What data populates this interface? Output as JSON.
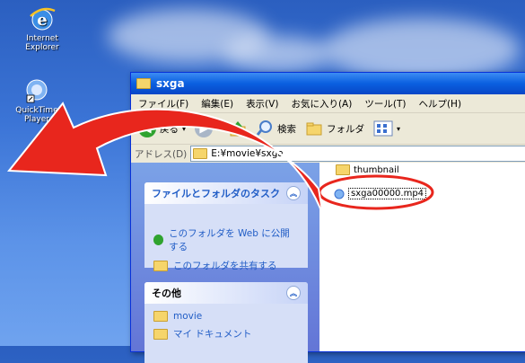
{
  "desktop": {
    "icons": [
      {
        "label": "Internet\nExplorer",
        "icon": "internet-explorer-icon"
      },
      {
        "label": "QuickTime\nPlayer",
        "icon": "quicktime-icon"
      }
    ]
  },
  "window": {
    "title": "sxga",
    "menu": [
      "ファイル(F)",
      "編集(E)",
      "表示(V)",
      "お気に入り(A)",
      "ツール(T)",
      "ヘルプ(H)"
    ],
    "toolbar": {
      "back": "戻る",
      "search": "検索",
      "folders": "フォルダ"
    },
    "address": {
      "label": "アドレス(D)",
      "path": "E:¥movie¥sxga"
    },
    "tasks_panel": {
      "title": "ファイルとフォルダのタスク",
      "links": [
        "このフォルダを Web に公開する",
        "このフォルダを共有する"
      ]
    },
    "other_panel": {
      "title": "その他",
      "links": [
        "movie",
        "マイ ドキュメント"
      ]
    },
    "files": [
      {
        "name": "thumbnail",
        "type": "folder"
      },
      {
        "name": "sxga00000.mp4",
        "type": "video"
      }
    ]
  },
  "annotation": {
    "color": "#e8261d"
  }
}
